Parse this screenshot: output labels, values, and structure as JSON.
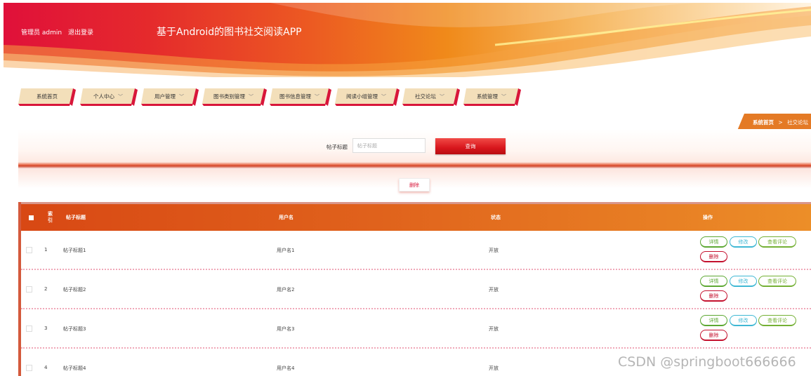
{
  "header": {
    "user_role": "管理员 admin",
    "logout": "退出登录",
    "title": "基于Android的图书社交阅读APP"
  },
  "nav": [
    {
      "label": "系统首页",
      "dropdown": false
    },
    {
      "label": "个人中心",
      "dropdown": true
    },
    {
      "label": "用户管理",
      "dropdown": true
    },
    {
      "label": "图书类别管理",
      "dropdown": true
    },
    {
      "label": "图书信息管理",
      "dropdown": true
    },
    {
      "label": "阅读小组管理",
      "dropdown": true
    },
    {
      "label": "社交论坛",
      "dropdown": true
    },
    {
      "label": "系统管理",
      "dropdown": true
    }
  ],
  "breadcrumb": {
    "home": "系统首页",
    "sep": ">",
    "current": "社交论坛"
  },
  "search": {
    "label": "帖子标题",
    "placeholder": "帖子标题",
    "button": "查询"
  },
  "toolbar": {
    "delete_label": "删除"
  },
  "table": {
    "headers": {
      "index": "索引",
      "title": "帖子标题",
      "user": "用户名",
      "status": "状态",
      "ops": "操作"
    },
    "rows": [
      {
        "index": "1",
        "title": "帖子标题1",
        "user": "用户名1",
        "status": "开放"
      },
      {
        "index": "2",
        "title": "帖子标题2",
        "user": "用户名2",
        "status": "开放"
      },
      {
        "index": "3",
        "title": "帖子标题3",
        "user": "用户名3",
        "status": "开放"
      },
      {
        "index": "4",
        "title": "帖子标题4",
        "user": "用户名4",
        "status": "开放"
      }
    ],
    "ops": {
      "detail": "详情",
      "edit": "修改",
      "comments": "查看评论",
      "delete": "删除"
    }
  },
  "watermark": "CSDN @springboot666666",
  "colors": {
    "accent": "#d8163a",
    "header_orange": "#ec8e28"
  }
}
